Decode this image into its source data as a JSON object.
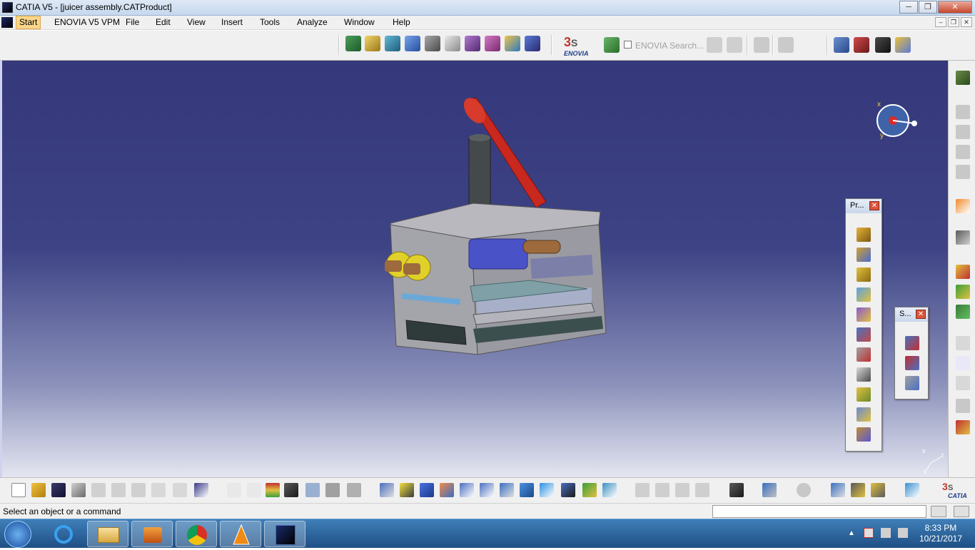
{
  "window": {
    "title": "CATIA V5 - [juicer assembly.CATProduct]",
    "min_label": "─",
    "max_label": "❐",
    "close_label": "✕"
  },
  "menu": {
    "items": [
      "Start",
      "ENOVIA V5 VPM",
      "File",
      "Edit",
      "View",
      "Insert",
      "Tools",
      "Analyze",
      "Window",
      "Help"
    ]
  },
  "mdi": {
    "min_label": "–",
    "max_label": "❐",
    "close_label": "✕"
  },
  "toolbar": {
    "enovia_logo_text": "ENOVIA",
    "enovia_search_placeholder": "ENOVIA Search..."
  },
  "palettes": {
    "product": {
      "title": "Pr...",
      "close_label": "✕"
    },
    "structure": {
      "title": "S...",
      "close_label": "✕"
    }
  },
  "compass": {
    "x_label": "x",
    "y_label": "y"
  },
  "axes": {
    "x": "x",
    "y": "y",
    "z": "z"
  },
  "catia_logo_text": "CATIA",
  "status": {
    "message": "Select an object or a command"
  },
  "taskbar": {
    "time": "8:33 PM",
    "date": "10/21/2017"
  },
  "colors": {
    "viewport_top": "#35387a",
    "viewport_bottom": "#e4e6f1",
    "accent": "#f9d58a"
  }
}
